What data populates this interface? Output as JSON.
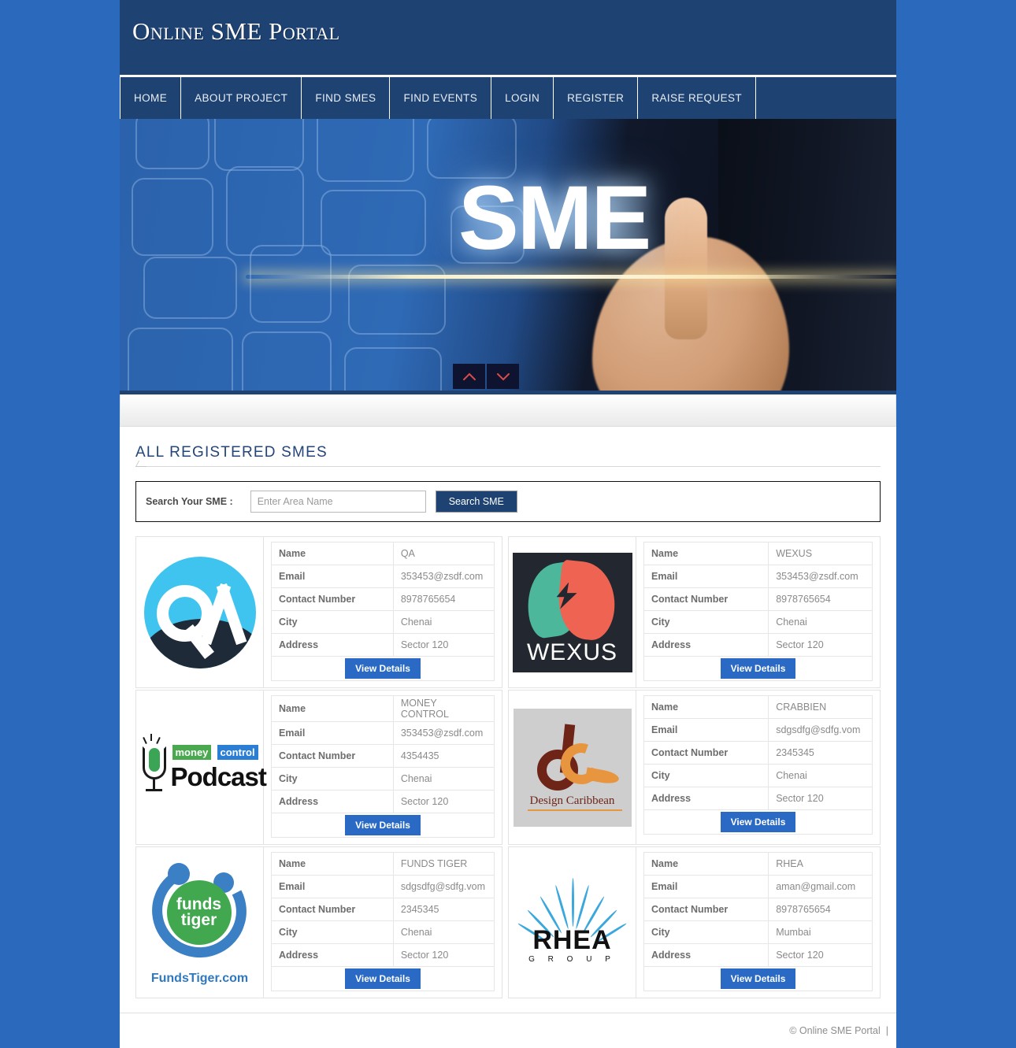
{
  "site": {
    "title": "Online SME Portal",
    "header_bg": "#1e4272",
    "page_bg": "#2a69bc",
    "accent": "#2a6ac5"
  },
  "nav": {
    "items": [
      {
        "label": "HOME",
        "name": "home"
      },
      {
        "label": "ABOUT PROJECT",
        "name": "about-project"
      },
      {
        "label": "FIND SMES",
        "name": "find-smes"
      },
      {
        "label": "FIND EVENTS",
        "name": "find-events"
      },
      {
        "label": "LOGIN",
        "name": "login"
      },
      {
        "label": "REGISTER",
        "name": "register"
      },
      {
        "label": "RAISE REQUEST",
        "name": "raise-request"
      }
    ]
  },
  "banner": {
    "word": "SME",
    "prev_label": "Previous slide",
    "next_label": "Next slide"
  },
  "section": {
    "title": "ALL REGISTERED SMES"
  },
  "search": {
    "label": "Search Your SME :",
    "placeholder": "Enter Area Name",
    "value": "",
    "button": "Search SME"
  },
  "table_headers": {
    "name": "Name",
    "email": "Email",
    "contact": "Contact Number",
    "city": "City",
    "address": "Address"
  },
  "buttons": {
    "view_details": "View Details"
  },
  "smes": [
    {
      "logo": "qa-logo",
      "name": "QA",
      "email": "353453@zsdf.com",
      "contact": "8978765654",
      "city": "Chenai",
      "address": "Sector 120"
    },
    {
      "logo": "wexus-logo",
      "logo_text": "WEXUS",
      "name": "WEXUS",
      "email": "353453@zsdf.com",
      "contact": "8978765654",
      "city": "Chenai",
      "address": "Sector 120"
    },
    {
      "logo": "moneycontrol-podcast-logo",
      "logo_text_1": "money",
      "logo_text_2": "control",
      "logo_text_3": "Podcast",
      "name": "MONEY CONTROL",
      "email": "353453@zsdf.com",
      "contact": "4354435",
      "city": "Chenai",
      "address": "Sector 120"
    },
    {
      "logo": "design-caribbean-logo",
      "logo_text": "Design Caribbean",
      "name": "CRABBIEN",
      "email": "sdgsdfg@sdfg.vom",
      "contact": "2345345",
      "city": "Chenai",
      "address": "Sector 120"
    },
    {
      "logo": "fundstiger-logo",
      "logo_text_1": "funds",
      "logo_text_2": "tiger",
      "logo_text_3": "FundsTiger.com",
      "name": "FUNDS TIGER",
      "email": "sdgsdfg@sdfg.vom",
      "contact": "2345345",
      "city": "Chenai",
      "address": "Sector 120"
    },
    {
      "logo": "rhea-group-logo",
      "logo_text_1": "RHEA",
      "logo_text_2": "G R O U P",
      "name": "RHEA",
      "email": "aman@gmail.com",
      "contact": "8978765654",
      "city": "Mumbai",
      "address": "Sector 120"
    }
  ],
  "footer": {
    "copyright": "© Online SME Portal",
    "separator": "|"
  }
}
